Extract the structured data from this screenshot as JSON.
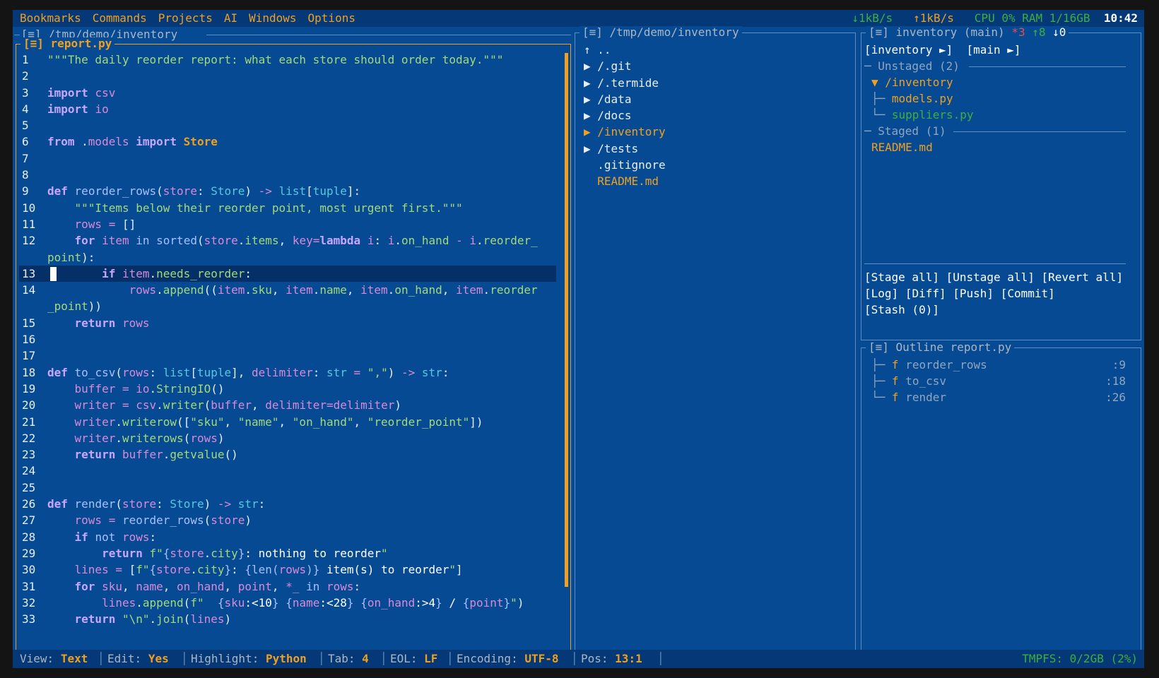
{
  "menubar": {
    "items": [
      "Bookmarks",
      "Commands",
      "Projects",
      "AI",
      "Windows",
      "Options"
    ],
    "net_down": "↓1kB/s",
    "net_up": "↑1kB/s",
    "cpu_ram": "CPU 0% RAM 1/16GB",
    "clock": "10:42"
  },
  "outer_panel": {
    "icon": "[≡]",
    "path": "/tmp/demo/inventory"
  },
  "editor": {
    "icon": "[≡]",
    "filename": "report.py",
    "cursor_line": 13
  },
  "files": {
    "icon": "[≡]",
    "path": "/tmp/demo/inventory",
    "items": [
      {
        "marker": "↑",
        "name": ".."
      },
      {
        "marker": "▶",
        "name": "/.git"
      },
      {
        "marker": "▶",
        "name": "/.termide"
      },
      {
        "marker": "▶",
        "name": "/data"
      },
      {
        "marker": "▶",
        "name": "/docs"
      },
      {
        "marker": "▶",
        "name": "/inventory"
      },
      {
        "marker": "▶",
        "name": "/tests"
      },
      {
        "marker": " ",
        "name": ".gitignore"
      },
      {
        "marker": " ",
        "name": "README.md"
      }
    ]
  },
  "git": {
    "icon": "[≡]",
    "repo": "inventory (main)",
    "modified": "*3",
    "ahead": "↑8",
    "behind": "↓0",
    "repo_button": "[inventory ►]",
    "branch_button": "[main ►]",
    "unstaged_header": "Unstaged (2)",
    "unstaged_folder": "/inventory",
    "unstaged_files": [
      "models.py",
      "suppliers.py"
    ],
    "staged_header": "Staged (1)",
    "staged_files": [
      "README.md"
    ],
    "buttons": {
      "stage_all": "[Stage all]",
      "unstage_all": "[Unstage all]",
      "revert_all": "[Revert all]",
      "log": "[Log]",
      "diff": "[Diff]",
      "push": "[Push]",
      "commit": "[Commit]",
      "stash": "[Stash (0)]"
    }
  },
  "outline": {
    "icon": "[≡]",
    "title": "Outline report.py",
    "items": [
      {
        "kind": "f",
        "name": "reorder_rows",
        "line": ":9"
      },
      {
        "kind": "f",
        "name": "to_csv",
        "line": ":18"
      },
      {
        "kind": "f",
        "name": "render",
        "line": ":26"
      }
    ]
  },
  "statusbar": {
    "view_label": "View:",
    "view_value": "Text",
    "edit_label": "Edit:",
    "edit_value": "Yes",
    "highlight_label": "Highlight:",
    "highlight_value": "Python",
    "tab_label": "Tab:",
    "tab_value": "4",
    "eol_label": "EOL:",
    "eol_value": "LF",
    "encoding_label": "Encoding:",
    "encoding_value": "UTF-8",
    "pos_label": "Pos:",
    "pos_value": "13:1",
    "tmpfs": "TMPFS: 0/2GB (2%)"
  }
}
